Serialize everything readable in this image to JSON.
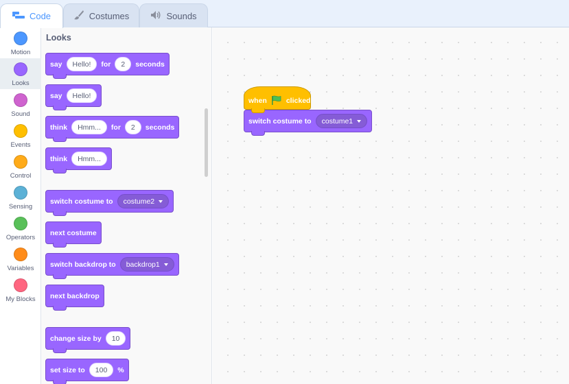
{
  "tabs": [
    {
      "label": "Code",
      "icon": "code-icon",
      "active": true
    },
    {
      "label": "Costumes",
      "icon": "brush-icon",
      "active": false
    },
    {
      "label": "Sounds",
      "icon": "speaker-icon",
      "active": false
    }
  ],
  "categories": [
    {
      "label": "Motion",
      "color": "#4c97ff"
    },
    {
      "label": "Looks",
      "color": "#9966ff",
      "selected": true
    },
    {
      "label": "Sound",
      "color": "#cf63cf"
    },
    {
      "label": "Events",
      "color": "#ffbf00"
    },
    {
      "label": "Control",
      "color": "#ffab19"
    },
    {
      "label": "Sensing",
      "color": "#5cb1d6"
    },
    {
      "label": "Operators",
      "color": "#59c059"
    },
    {
      "label": "Variables",
      "color": "#ff8c1a"
    },
    {
      "label": "My Blocks",
      "color": "#ff6680"
    }
  ],
  "palette": {
    "title": "Looks",
    "say_for": {
      "say": "say",
      "message": "Hello!",
      "for": "for",
      "secs": "2",
      "seconds": "seconds"
    },
    "say": {
      "say": "say",
      "message": "Hello!"
    },
    "think_for": {
      "think": "think",
      "message": "Hmm...",
      "for": "for",
      "secs": "2",
      "seconds": "seconds"
    },
    "think": {
      "think": "think",
      "message": "Hmm..."
    },
    "switch_costume": {
      "label": "switch costume to",
      "value": "costume2"
    },
    "next_costume": {
      "label": "next costume"
    },
    "switch_backdrop": {
      "label": "switch backdrop to",
      "value": "backdrop1"
    },
    "next_backdrop": {
      "label": "next backdrop"
    },
    "change_size": {
      "label": "change size by",
      "value": "10"
    },
    "set_size": {
      "label": "set size to",
      "value": "100",
      "unit": "%"
    }
  },
  "script": {
    "hat": {
      "when": "when",
      "clicked": "clicked",
      "icon": "green-flag-icon"
    },
    "switch_costume": {
      "label": "switch costume to",
      "value": "costume1"
    }
  },
  "colors": {
    "looks": "#9966ff",
    "events": "#ffbf00",
    "accent": "#4c97ff"
  }
}
